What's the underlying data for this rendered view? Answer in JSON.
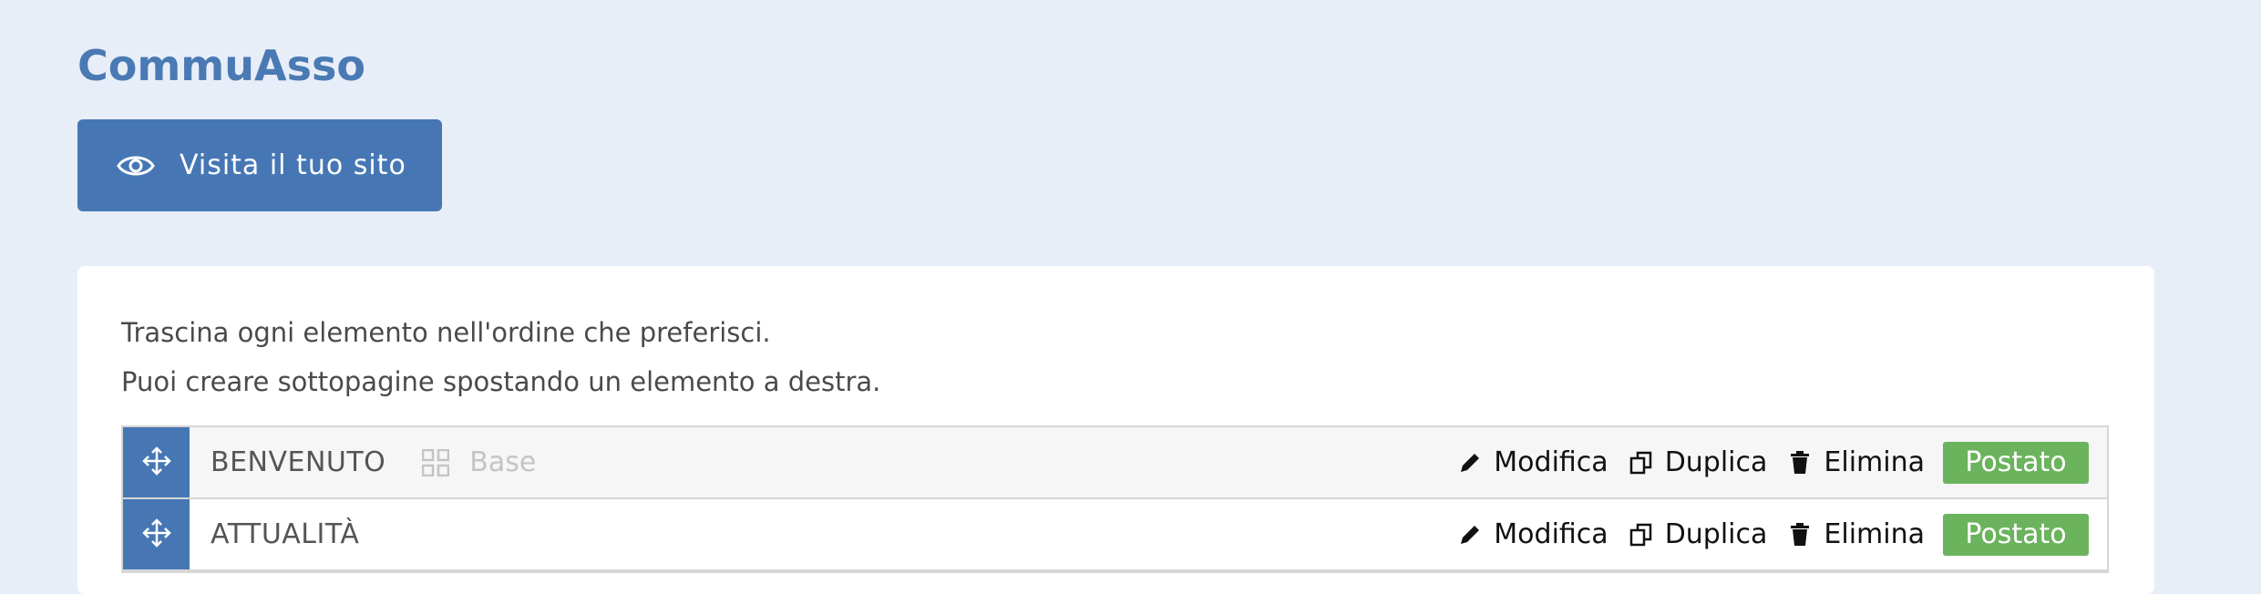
{
  "site": {
    "title": "CommuAsso"
  },
  "visit_button": {
    "label": "Visita il tuo sito",
    "icon": "eye-icon"
  },
  "intro": {
    "line1": "Trascina ogni elemento nell'ordine che preferisci.",
    "line2": "Puoi creare sottopagine spostando un elemento a destra."
  },
  "pages": [
    {
      "title": "BENVENUTO",
      "template": "Base",
      "actions": {
        "edit": "Modifica",
        "duplicate": "Duplica",
        "delete": "Elimina"
      },
      "status": "Postato"
    },
    {
      "title": "ATTUALITÀ",
      "actions": {
        "edit": "Modifica",
        "duplicate": "Duplica",
        "delete": "Elimina"
      },
      "status": "Postato"
    }
  ],
  "colors": {
    "accent": "#4677b4",
    "background": "#e8eef8",
    "status_published": "#6bb35c"
  }
}
